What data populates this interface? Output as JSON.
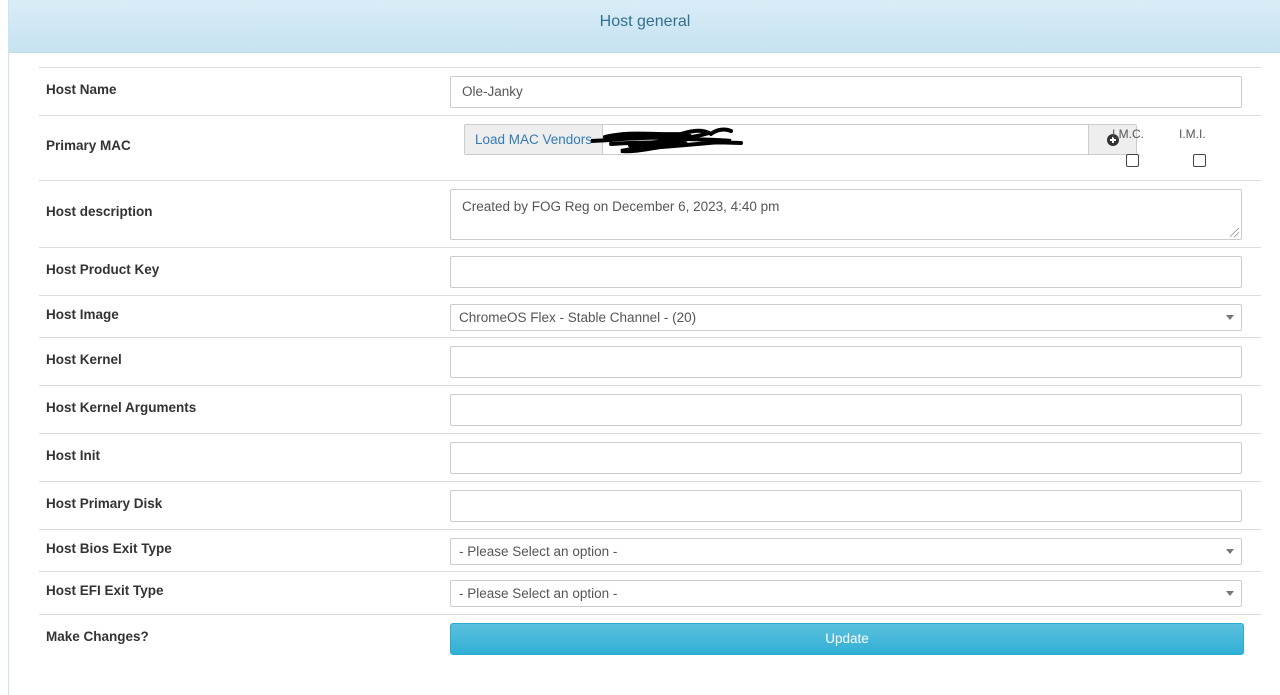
{
  "header": {
    "title": "Host general"
  },
  "fields": {
    "host_name": {
      "label": "Host Name",
      "value": "Ole-Janky"
    },
    "primary_mac": {
      "label": "Primary MAC",
      "load_vendors_label": "Load MAC Vendors",
      "imc_label": "I.M.C.",
      "imi_label": "I.M.I.",
      "imc_checked": false,
      "imi_checked": false
    },
    "host_description": {
      "label": "Host description",
      "value": "Created by FOG Reg on December 6, 2023, 4:40 pm"
    },
    "host_product_key": {
      "label": "Host Product Key",
      "value": ""
    },
    "host_image": {
      "label": "Host Image",
      "value": "ChromeOS Flex - Stable Channel - (20)"
    },
    "host_kernel": {
      "label": "Host Kernel",
      "value": ""
    },
    "host_kernel_arguments": {
      "label": "Host Kernel Arguments",
      "value": ""
    },
    "host_init": {
      "label": "Host Init",
      "value": ""
    },
    "host_primary_disk": {
      "label": "Host Primary Disk",
      "value": ""
    },
    "host_bios_exit_type": {
      "label": "Host Bios Exit Type",
      "value": "- Please Select an option -"
    },
    "host_efi_exit_type": {
      "label": "Host EFI Exit Type",
      "value": "- Please Select an option -"
    },
    "make_changes": {
      "label": "Make Changes?",
      "button_label": "Update"
    }
  },
  "colors": {
    "header_bg": "#d9edf7",
    "header_text": "#31708f",
    "link": "#337ab7",
    "button_bg": "#5bc0de"
  }
}
